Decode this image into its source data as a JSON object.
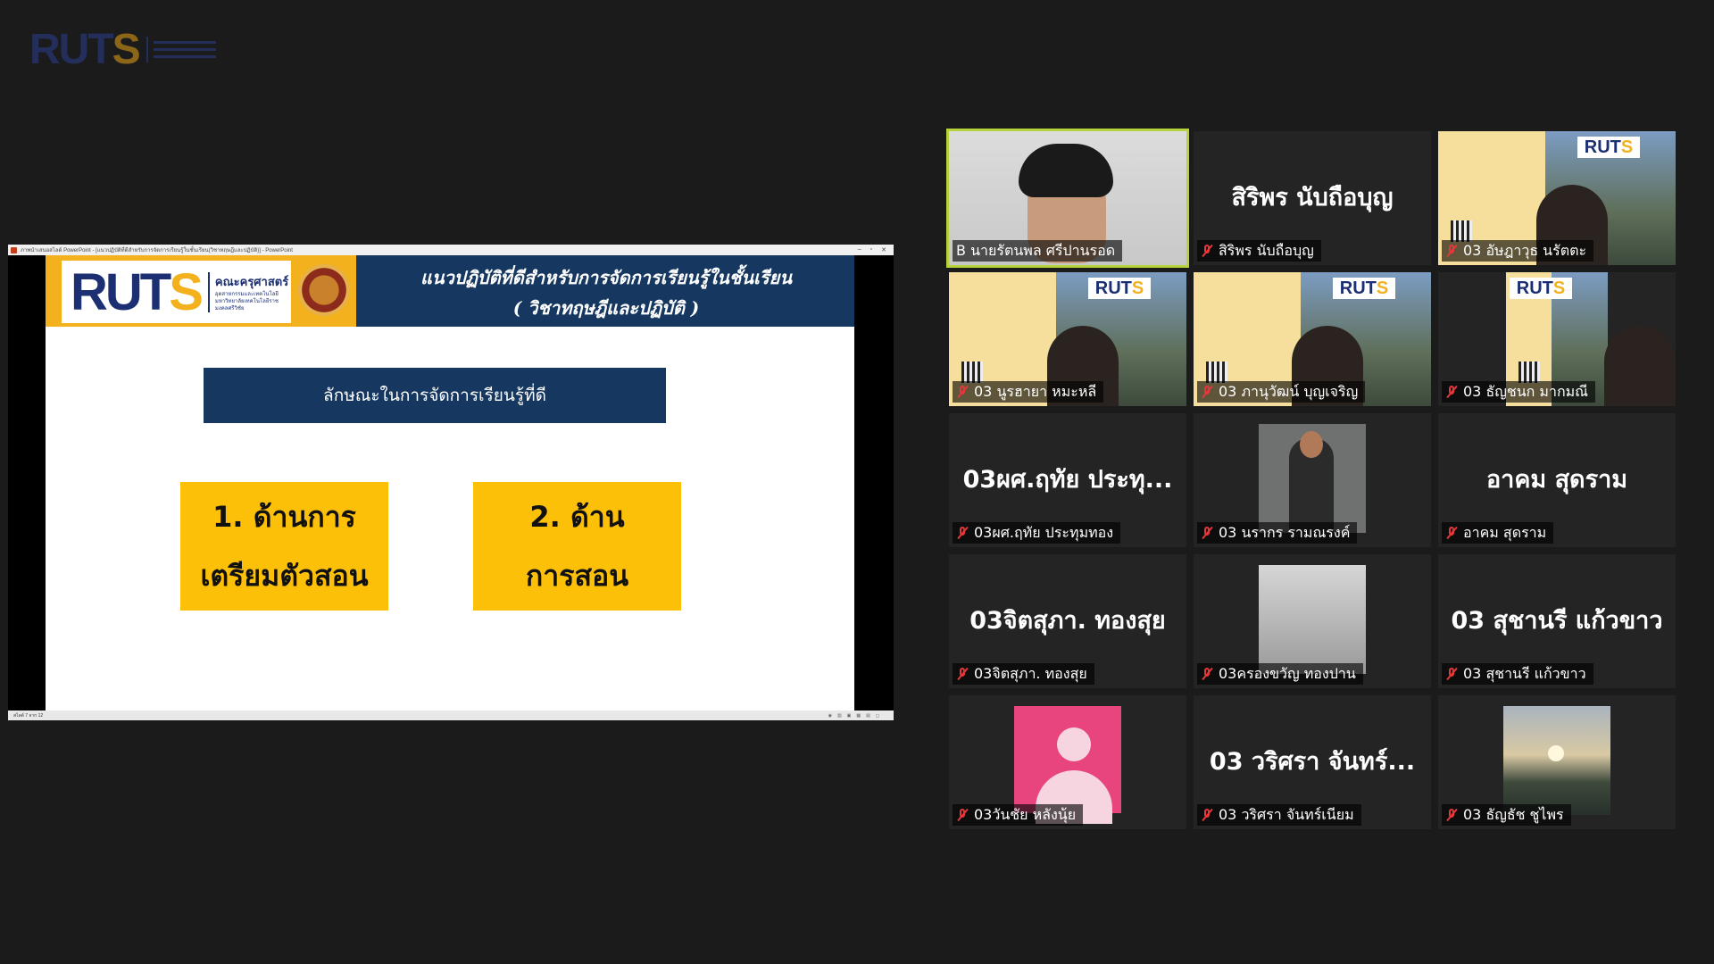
{
  "watermark": {
    "logo_text_a": "RUT",
    "logo_text_b": "S"
  },
  "share_window": {
    "titlebar_text": "ภาพนำเสนอสไลด์ PowerPoint - [แนวปฏิบัติที่ดีสำหรับการจัดการเรียนรู้ในชั้นเรียน(วิชาทฤษฎีและปฏิบัติ)] - PowerPoint",
    "status_text": "สไลด์ 7 จาก 12"
  },
  "slide": {
    "logo_a": "RUT",
    "logo_b": "S",
    "faculty": "คณะครุศาสตร์",
    "faculty_sub1": "อุตสาหกรรมและเทคโนโลยี",
    "faculty_sub2": "มหาวิทยาลัยเทคโนโลยีราชมงคลศรีวิชัย",
    "title_line1": "แนวปฏิบัติที่ดีสำหรับการจัดการเรียนรู้ในชั้นเรียน",
    "title_line2": "( วิชาทฤษฎีและปฏิบัติ )",
    "subtitle": "ลักษณะในการจัดการเรียนรู้ที่ดี",
    "box1_line1": "1. ด้านการ",
    "box1_line2": "เตรียมตัวสอน",
    "box2_line1": "2. ด้าน",
    "box2_line2": "การสอน"
  },
  "participants": [
    {
      "label": "B นายรัตนพล ศรีปานรอด",
      "big": "",
      "muted": false,
      "active": true,
      "video": "face"
    },
    {
      "label": "สิริพร นับถือบุญ",
      "big": "สิริพร นับถือบุญ",
      "muted": true,
      "active": false,
      "video": "none"
    },
    {
      "label": "03 อัษฎาวุธ  นรัตตะ",
      "big": "",
      "muted": true,
      "active": false,
      "video": "poster"
    },
    {
      "label": "03 นูรฮายา หมะหลี",
      "big": "",
      "muted": true,
      "active": false,
      "video": "poster"
    },
    {
      "label": "03 ภานุวัฒน์ บุญเจริญ",
      "big": "",
      "muted": true,
      "active": false,
      "video": "poster"
    },
    {
      "label": "03 ธัญชนก มากมณี",
      "big": "",
      "muted": true,
      "active": false,
      "video": "poster"
    },
    {
      "label": "03ผศ.ฤทัย ประทุมทอง",
      "big": "03ผศ.ฤทัย ประทุ...",
      "muted": true,
      "active": false,
      "video": "none"
    },
    {
      "label": "03 นรากร รามณรงค์",
      "big": "",
      "muted": true,
      "active": false,
      "video": "person"
    },
    {
      "label": "อาคม สุดราม",
      "big": "อาคม สุดราม",
      "muted": true,
      "active": false,
      "video": "none"
    },
    {
      "label": "03จิตสุภา. ทองสุย",
      "big": "03จิตสุภา. ทองสุย",
      "muted": true,
      "active": false,
      "video": "none"
    },
    {
      "label": "03ครองขวัญ ทองปาน",
      "big": "",
      "muted": true,
      "active": false,
      "video": "photo"
    },
    {
      "label": "03 สุชานรี แก้วขาว",
      "big": "03 สุชานรี แก้วขาว",
      "muted": true,
      "active": false,
      "video": "none"
    },
    {
      "label": "03วันชัย หลังนุ้ย",
      "big": "",
      "muted": true,
      "active": false,
      "video": "avatar"
    },
    {
      "label": "03 วริศรา จันทร์เนียม",
      "big": "03 วริศรา จันทร์...",
      "muted": true,
      "active": false,
      "video": "none"
    },
    {
      "label": "03 ธัญธัช  ชูไพร",
      "big": "",
      "muted": true,
      "active": false,
      "video": "sunset"
    }
  ]
}
